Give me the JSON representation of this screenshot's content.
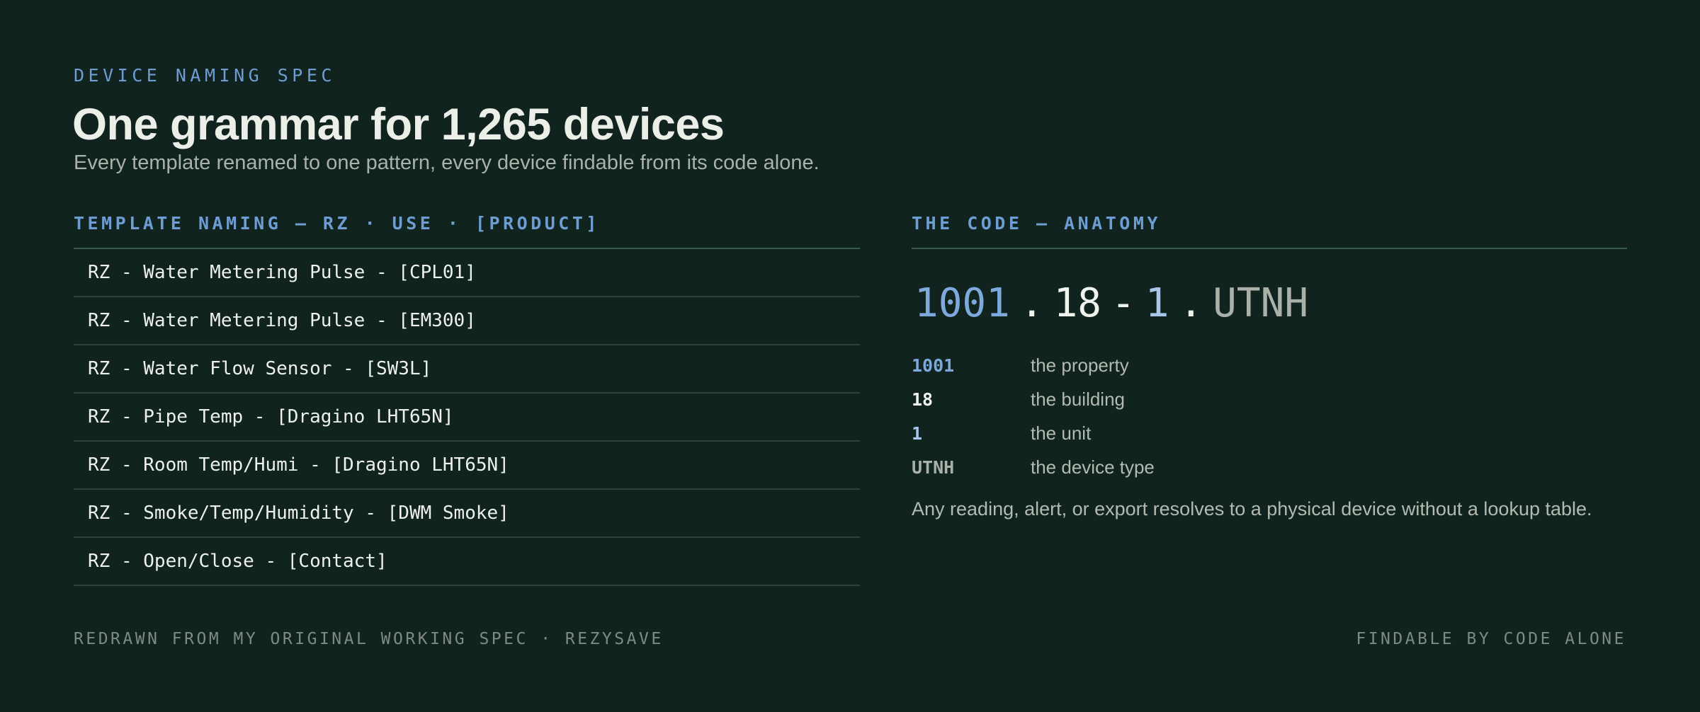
{
  "header": {
    "eyebrow": "DEVICE NAMING SPEC",
    "title": "One grammar for 1,265 devices",
    "subtitle": "Every template renamed to one pattern, every device findable from its code alone."
  },
  "template_naming": {
    "heading": "TEMPLATE NAMING — RZ · USE · [PRODUCT]",
    "items": [
      "RZ - Water Metering Pulse - [CPL01]",
      "RZ - Water Metering Pulse - [EM300]",
      "RZ - Water Flow Sensor - [SW3L]",
      "RZ - Pipe Temp - [Dragino LHT65N]",
      "RZ - Room Temp/Humi - [Dragino LHT65N]",
      "RZ - Smoke/Temp/Humidity - [DWM Smoke]",
      "RZ - Open/Close - [Contact]"
    ]
  },
  "anatomy": {
    "heading": "THE CODE — ANATOMY",
    "code": {
      "property": "1001",
      "sep1": ".",
      "building": "18",
      "sep2": "-",
      "unit": "1",
      "sep3": ".",
      "type": "UTNH"
    },
    "legend": [
      {
        "key": "1001",
        "desc": "the property"
      },
      {
        "key": "18",
        "desc": "the building"
      },
      {
        "key": "1",
        "desc": "the unit"
      },
      {
        "key": "UTNH",
        "desc": "the device type"
      }
    ],
    "note": "Any reading, alert, or export resolves to a physical device without a lookup table."
  },
  "footer": {
    "left": "REDRAWN FROM MY ORIGINAL WORKING SPEC · REZYSAVE",
    "right": "FINDABLE BY CODE ALONE"
  },
  "colors": {
    "background": "#11231e",
    "accent_blue": "#6e9dd3",
    "text_primary": "#eceee8",
    "text_muted": "#a9b1a8"
  }
}
